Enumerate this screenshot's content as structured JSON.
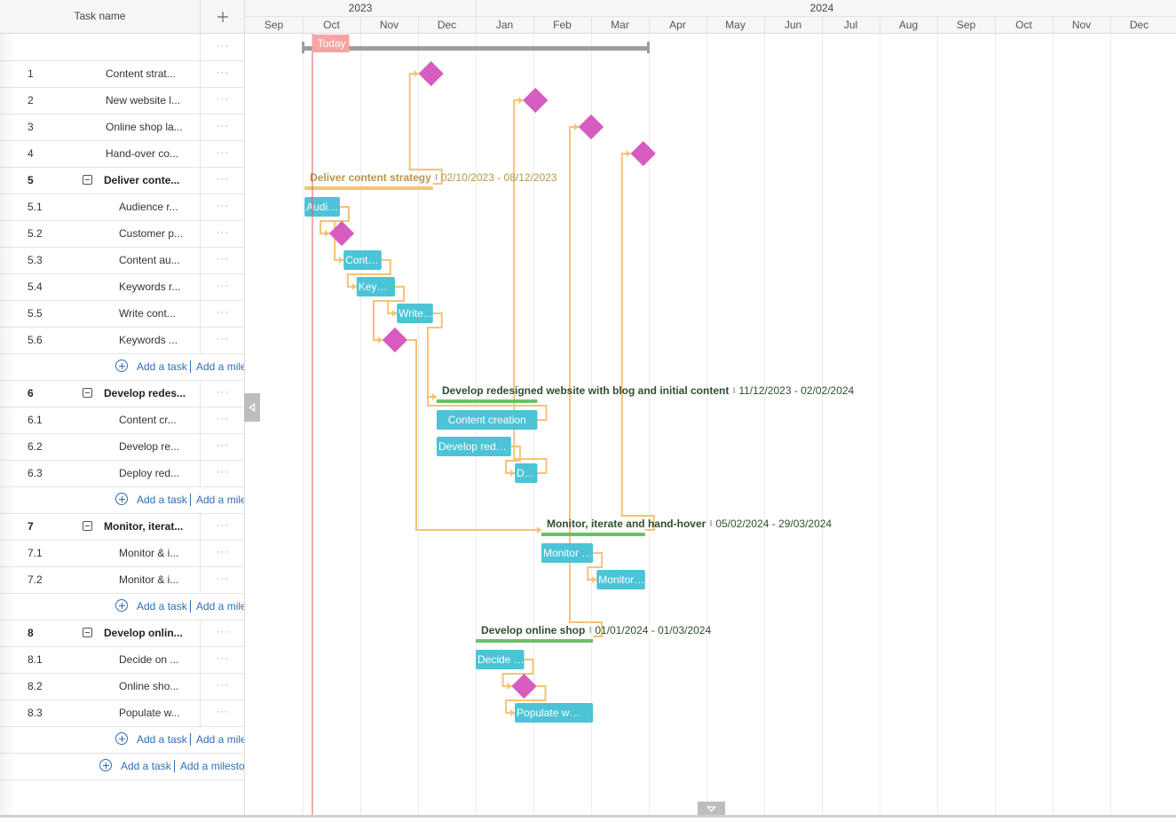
{
  "grid": {
    "header": {
      "task_name": "Task name",
      "add_icon": "plus-icon"
    },
    "rows": [
      {
        "type": "project",
        "num": "",
        "name": ""
      },
      {
        "type": "milestone",
        "num": "1",
        "name": "Content strat..."
      },
      {
        "type": "milestone",
        "num": "2",
        "name": "New website l..."
      },
      {
        "type": "milestone",
        "num": "3",
        "name": "Online shop la..."
      },
      {
        "type": "milestone",
        "num": "4",
        "name": "Hand-over co..."
      },
      {
        "type": "parent",
        "num": "5",
        "name": "Deliver conte..."
      },
      {
        "type": "child",
        "num": "5.1",
        "name": "Audience r..."
      },
      {
        "type": "child",
        "num": "5.2",
        "name": "Customer p..."
      },
      {
        "type": "child",
        "num": "5.3",
        "name": "Content au..."
      },
      {
        "type": "child",
        "num": "5.4",
        "name": "Keywords r..."
      },
      {
        "type": "child",
        "num": "5.5",
        "name": "Write cont..."
      },
      {
        "type": "child",
        "num": "5.6",
        "name": "Keywords ..."
      },
      {
        "type": "add"
      },
      {
        "type": "parent",
        "num": "6",
        "name": "Develop redes..."
      },
      {
        "type": "child",
        "num": "6.1",
        "name": "Content cr..."
      },
      {
        "type": "child",
        "num": "6.2",
        "name": "Develop re..."
      },
      {
        "type": "child",
        "num": "6.3",
        "name": "Deploy red..."
      },
      {
        "type": "add"
      },
      {
        "type": "parent",
        "num": "7",
        "name": "Monitor, iterat..."
      },
      {
        "type": "child",
        "num": "7.1",
        "name": "Monitor & i..."
      },
      {
        "type": "child",
        "num": "7.2",
        "name": "Monitor & i..."
      },
      {
        "type": "add"
      },
      {
        "type": "parent",
        "num": "8",
        "name": "Develop onlin..."
      },
      {
        "type": "child",
        "num": "8.1",
        "name": "Decide on ..."
      },
      {
        "type": "child",
        "num": "8.2",
        "name": "Online sho..."
      },
      {
        "type": "child",
        "num": "8.3",
        "name": "Populate w..."
      },
      {
        "type": "add"
      },
      {
        "type": "add_root"
      }
    ],
    "menu_label": "···",
    "add_task_label": "Add a task",
    "add_milestone_label": "Add a milestone"
  },
  "timeline": {
    "years": [
      {
        "label": "2023",
        "months": 4
      },
      {
        "label": "2024",
        "months": 12
      }
    ],
    "months": [
      "Sep",
      "Oct",
      "Nov",
      "Dec",
      "Jan",
      "Feb",
      "Mar",
      "Apr",
      "May",
      "Jun",
      "Jul",
      "Aug",
      "Sep",
      "Oct",
      "Nov",
      "Dec"
    ],
    "start": "2023-09-01",
    "today": {
      "label": "Today",
      "date": "2023-10-06"
    },
    "colors": {
      "task": "#4cc3d6",
      "milestone": "#d65cbf",
      "summary_orange": "#f2c47a",
      "summary_green": "#6cbf6c",
      "link": "#f7c274",
      "today": "#f7a3a3",
      "today_line": "#e05a5a",
      "project_bar": "#9e9e9e",
      "label_orange": "#b8964a",
      "label_green": "#2f4f2f"
    }
  },
  "bars": [
    {
      "row": 0,
      "kind": "project",
      "start": "2023-10-01",
      "end": "2024-03-31"
    },
    {
      "row": 1,
      "kind": "milestone",
      "date": "2023-12-08"
    },
    {
      "row": 2,
      "kind": "milestone",
      "date": "2024-02-02"
    },
    {
      "row": 3,
      "kind": "milestone",
      "date": "2024-03-01"
    },
    {
      "row": 4,
      "kind": "milestone",
      "date": "2024-03-29"
    },
    {
      "row": 5,
      "kind": "summary",
      "color": "orange",
      "start": "2023-10-02",
      "end": "2023-12-08",
      "title": "Deliver content strategy",
      "dates": "02/10/2023 - 08/12/2023"
    },
    {
      "row": 6,
      "kind": "task",
      "start": "2023-10-02",
      "end": "2023-10-20",
      "label": "Audi…"
    },
    {
      "row": 7,
      "kind": "milestone",
      "date": "2023-10-22"
    },
    {
      "row": 8,
      "kind": "task",
      "start": "2023-10-23",
      "end": "2023-11-11",
      "label": "Cont…"
    },
    {
      "row": 9,
      "kind": "task",
      "start": "2023-10-30",
      "end": "2023-11-18",
      "label": "Key…"
    },
    {
      "row": 10,
      "kind": "task",
      "start": "2023-11-20",
      "end": "2023-12-08",
      "label": "Write…"
    },
    {
      "row": 11,
      "kind": "milestone",
      "date": "2023-11-19"
    },
    {
      "row": 13,
      "kind": "summary",
      "color": "green",
      "start": "2023-12-11",
      "end": "2024-02-02",
      "title": "Develop redesigned website with blog and initial content",
      "dates": "11/12/2023 - 02/02/2024"
    },
    {
      "row": 14,
      "kind": "task",
      "start": "2023-12-11",
      "end": "2024-02-02",
      "label": "Content creation",
      "center": true
    },
    {
      "row": 15,
      "kind": "task",
      "start": "2023-12-11",
      "end": "2024-01-19",
      "label": "Develop red…"
    },
    {
      "row": 16,
      "kind": "task",
      "start": "2024-01-22",
      "end": "2024-02-02",
      "label": "D…"
    },
    {
      "row": 18,
      "kind": "summary",
      "color": "green",
      "start": "2024-02-05",
      "end": "2024-03-29",
      "title": "Monitor, iterate and hand-hover",
      "dates": "05/02/2024 - 29/03/2024"
    },
    {
      "row": 19,
      "kind": "task",
      "start": "2024-02-05",
      "end": "2024-03-01",
      "label": "Monitor …"
    },
    {
      "row": 20,
      "kind": "task",
      "start": "2024-03-04",
      "end": "2024-03-29",
      "label": "Monitor…"
    },
    {
      "row": 22,
      "kind": "summary",
      "color": "green",
      "start": "2024-01-01",
      "end": "2024-03-01",
      "title": "Develop online shop",
      "dates": "01/01/2024 - 01/03/2024"
    },
    {
      "row": 23,
      "kind": "task",
      "start": "2024-01-01",
      "end": "2024-01-26",
      "label": "Decide …"
    },
    {
      "row": 24,
      "kind": "milestone",
      "date": "2024-01-27"
    },
    {
      "row": 25,
      "kind": "task",
      "start": "2024-01-22",
      "end": "2024-03-01",
      "label": "Populate w…"
    }
  ],
  "links": [
    [
      6,
      7
    ],
    [
      6,
      8
    ],
    [
      8,
      9
    ],
    [
      9,
      10
    ],
    [
      9,
      11
    ],
    [
      5,
      1
    ],
    [
      10,
      13
    ],
    [
      14,
      13
    ],
    [
      15,
      16
    ],
    [
      16,
      2
    ],
    [
      11,
      18
    ],
    [
      19,
      20
    ],
    [
      18,
      4
    ],
    [
      23,
      24
    ],
    [
      24,
      25
    ],
    [
      22,
      3
    ]
  ]
}
